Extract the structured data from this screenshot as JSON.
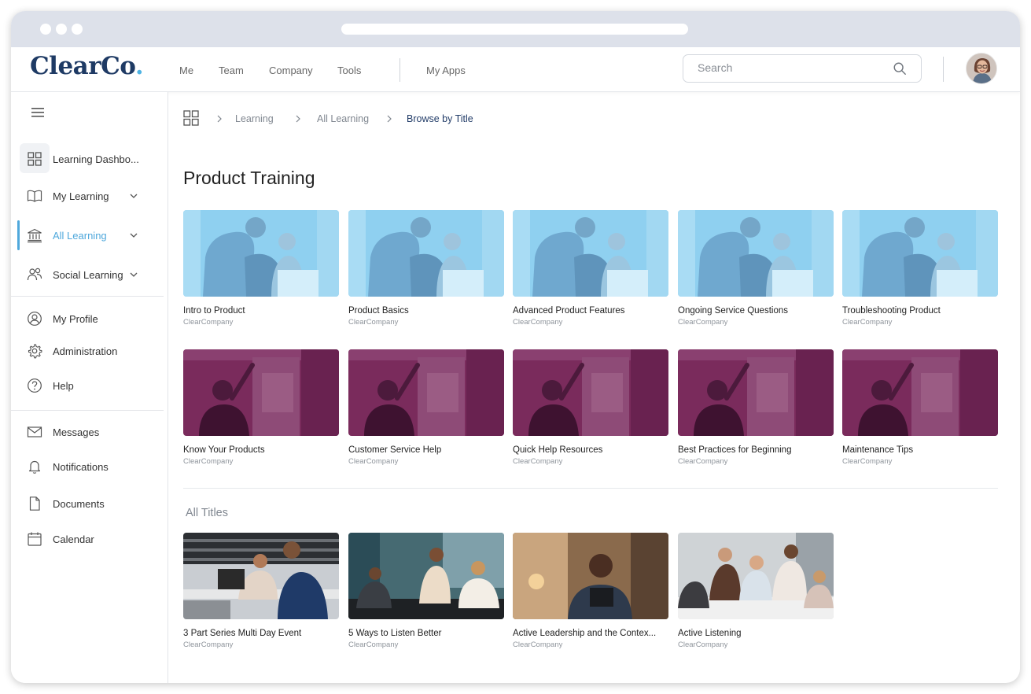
{
  "brand": {
    "logo_main": "ClearCo",
    "logo_dot": "."
  },
  "topnav": {
    "items": [
      "Me",
      "Team",
      "Company",
      "Tools"
    ],
    "apps_label": "My Apps",
    "search_placeholder": "Search"
  },
  "sidebar": {
    "items": [
      {
        "label": "Learning Dashbo...",
        "icon": "grid-icon"
      },
      {
        "label": "My Learning",
        "icon": "book-icon"
      },
      {
        "label": "All Learning",
        "icon": "institution-icon"
      },
      {
        "label": "Social Learning",
        "icon": "people-icon"
      },
      {
        "label": "My Profile",
        "icon": "user-circle-icon"
      },
      {
        "label": "Administration",
        "icon": "gear-icon"
      },
      {
        "label": "Help",
        "icon": "help-icon"
      },
      {
        "label": "Messages",
        "icon": "envelope-icon"
      },
      {
        "label": "Notifications",
        "icon": "bell-icon"
      },
      {
        "label": "Documents",
        "icon": "document-icon"
      },
      {
        "label": "Calendar",
        "icon": "calendar-icon"
      }
    ],
    "active_index": 2
  },
  "breadcrumb": [
    "Learning",
    "All Learning",
    "Browse by Title"
  ],
  "page_title": "Product Training",
  "section_title": "All Titles",
  "colors": {
    "accent": "#4fa8dc",
    "brand": "#1e3a64",
    "blue_tint": "#8fd0f0",
    "purple_tint": "#7a2b5c"
  },
  "rows": [
    {
      "tint": "blue",
      "cards": [
        {
          "title": "Intro to Product",
          "sub": "ClearCompany"
        },
        {
          "title": "Product Basics",
          "sub": "ClearCompany"
        },
        {
          "title": "Advanced Product Features",
          "sub": "ClearCompany"
        },
        {
          "title": "Ongoing Service Questions",
          "sub": "ClearCompany"
        },
        {
          "title": "Troubleshooting Product",
          "sub": "ClearCompany"
        }
      ]
    },
    {
      "tint": "purple",
      "cards": [
        {
          "title": "Know Your Products",
          "sub": "ClearCompany"
        },
        {
          "title": "Customer Service Help",
          "sub": "ClearCompany"
        },
        {
          "title": "Quick Help Resources",
          "sub": "ClearCompany"
        },
        {
          "title": "Best Practices for Beginning",
          "sub": "ClearCompany"
        },
        {
          "title": "Maintenance Tips",
          "sub": "ClearCompany"
        }
      ]
    },
    {
      "tint": "photo",
      "cards": [
        {
          "title": "3 Part Series Multi Day Event",
          "sub": "ClearCompany"
        },
        {
          "title": "5 Ways to Listen Better",
          "sub": "ClearCompany"
        },
        {
          "title": "Active Leadership and the Contex...",
          "sub": "ClearCompany"
        },
        {
          "title": "Active Listening",
          "sub": "ClearCompany"
        }
      ]
    }
  ]
}
